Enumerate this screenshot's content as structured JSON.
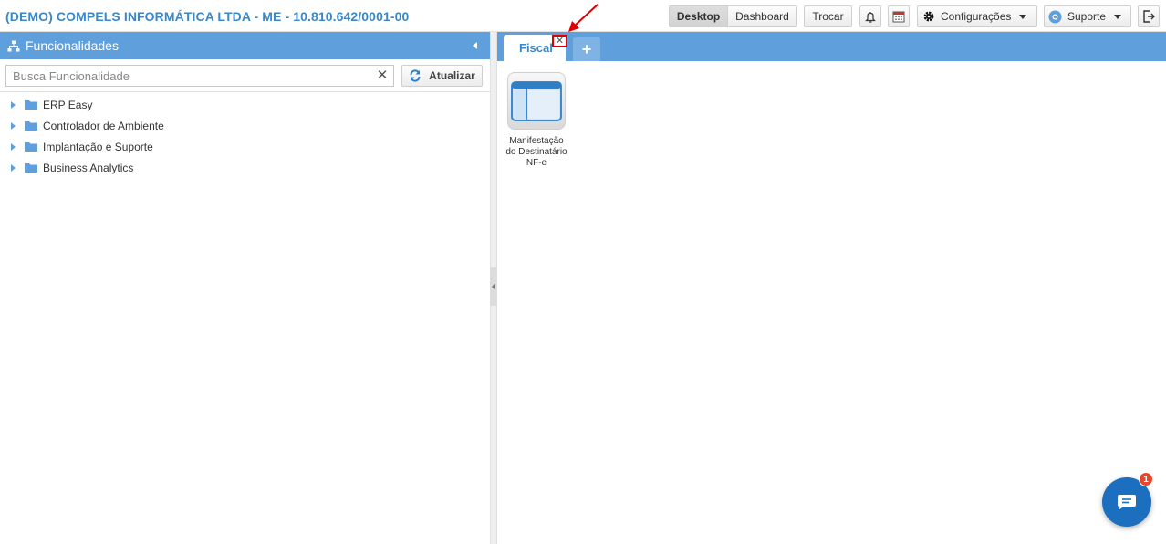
{
  "header": {
    "company_title": "(DEMO) COMPELS INFORMÁTICA LTDA - ME - 10.810.642/0001-00",
    "buttons": {
      "desktop": "Desktop",
      "dashboard": "Dashboard",
      "trocar": "Trocar",
      "configuracoes": "Configurações",
      "suporte": "Suporte"
    },
    "icons": [
      "bell-icon",
      "calendar-icon",
      "gear-icon",
      "support-icon",
      "logout-icon"
    ]
  },
  "sidebar": {
    "title": "Funcionalidades",
    "search": {
      "placeholder": "Busca Funcionalidade",
      "value": ""
    },
    "refresh_label": "Atualizar",
    "items": [
      {
        "label": "ERP Easy"
      },
      {
        "label": "Controlador de Ambiente"
      },
      {
        "label": "Implantação e Suporte"
      },
      {
        "label": "Business Analytics"
      }
    ]
  },
  "workspace": {
    "tabs": [
      {
        "label": "Fiscal",
        "active": true
      }
    ],
    "add_tab_label": "+",
    "desktop_items": [
      {
        "label": "Manifestação do Destinatário NF-e"
      }
    ]
  },
  "chat": {
    "badge_count": "1"
  },
  "colors": {
    "accent": "#5fa0dc",
    "title_blue": "#3a87c8",
    "annotation_red": "#e00000",
    "chat_blue": "#1c6fbf",
    "badge_red": "#e8462c"
  }
}
